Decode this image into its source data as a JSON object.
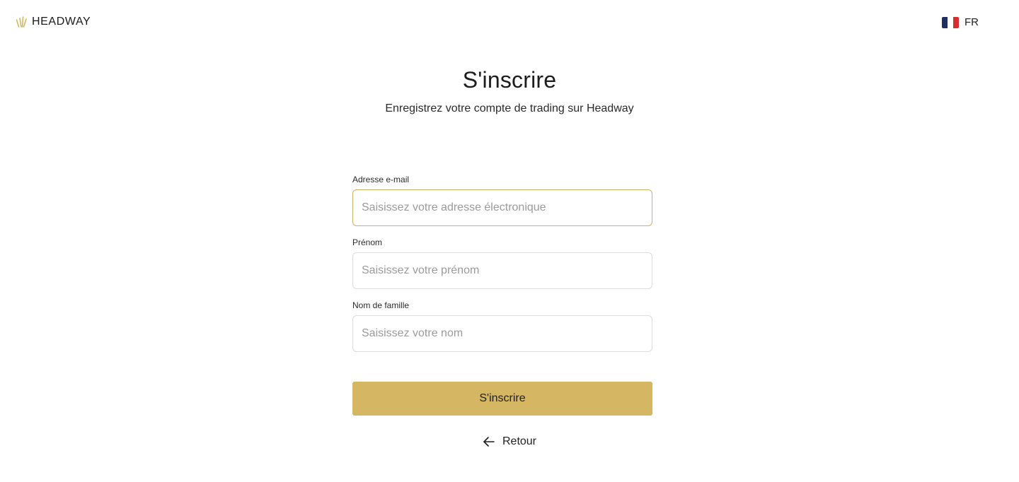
{
  "header": {
    "logo_text": "HEADWAY",
    "language": {
      "code": "FR",
      "flag": "flag-fr-icon"
    }
  },
  "main": {
    "title": "S'inscrire",
    "subtitle": "Enregistrez votre compte de trading sur Headway"
  },
  "form": {
    "email": {
      "label": "Adresse e-mail",
      "placeholder": "Saisissez votre adresse électronique",
      "value": ""
    },
    "first_name": {
      "label": "Prénom",
      "placeholder": "Saisissez votre prénom",
      "value": ""
    },
    "last_name": {
      "label": "Nom de famille",
      "placeholder": "Saisissez votre nom",
      "value": ""
    },
    "submit_label": "S'inscrire",
    "back_label": "Retour"
  },
  "colors": {
    "accent": "#d4b663",
    "focus_border": "#cfb063",
    "flag_blue": "#1e2f68",
    "flag_red": "#d32f2f"
  }
}
